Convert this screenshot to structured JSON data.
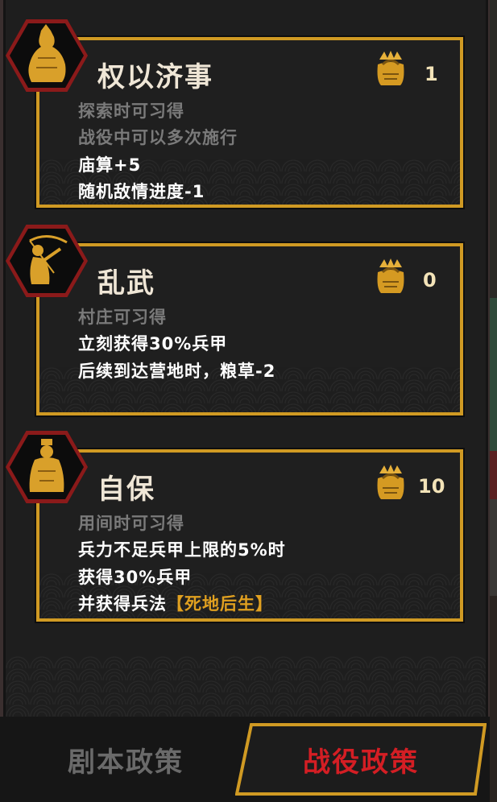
{
  "cards": [
    {
      "title": "权以济事",
      "cost": "1",
      "lines": [
        {
          "text": "探索时可习得",
          "tone": "grey"
        },
        {
          "text": "战役中可以多次施行",
          "tone": "grey"
        },
        {
          "text": "庙算+5",
          "tone": "white"
        },
        {
          "text": "随机敌情进度-1",
          "tone": "white"
        }
      ],
      "portrait": "general-with-helmet-icon"
    },
    {
      "title": "乱武",
      "cost": "0",
      "lines": [
        {
          "text": "村庄可习得",
          "tone": "grey"
        },
        {
          "text": "立刻获得30%兵甲",
          "tone": "white"
        },
        {
          "text": "后续到达营地时，粮草-2",
          "tone": "white"
        }
      ],
      "portrait": "archer-icon"
    },
    {
      "title": "自保",
      "cost": "10",
      "lines": [
        {
          "text": "用间时可习得",
          "tone": "grey"
        },
        {
          "text": "兵力不足兵甲上限的5%时",
          "tone": "white"
        },
        {
          "text": "获得30%兵甲",
          "tone": "white"
        },
        {
          "text": "并获得兵法",
          "tone": "white"
        }
      ],
      "highlight": "【死地后生】",
      "portrait": "official-seated-icon"
    }
  ],
  "tabs": {
    "script_policy": "剧本政策",
    "campaign_policy": "战役政策"
  },
  "colors": {
    "accent_gold": "#d09a23",
    "active_tab_red": "#d41e24",
    "portrait_frame_red": "#8b1a1a"
  }
}
